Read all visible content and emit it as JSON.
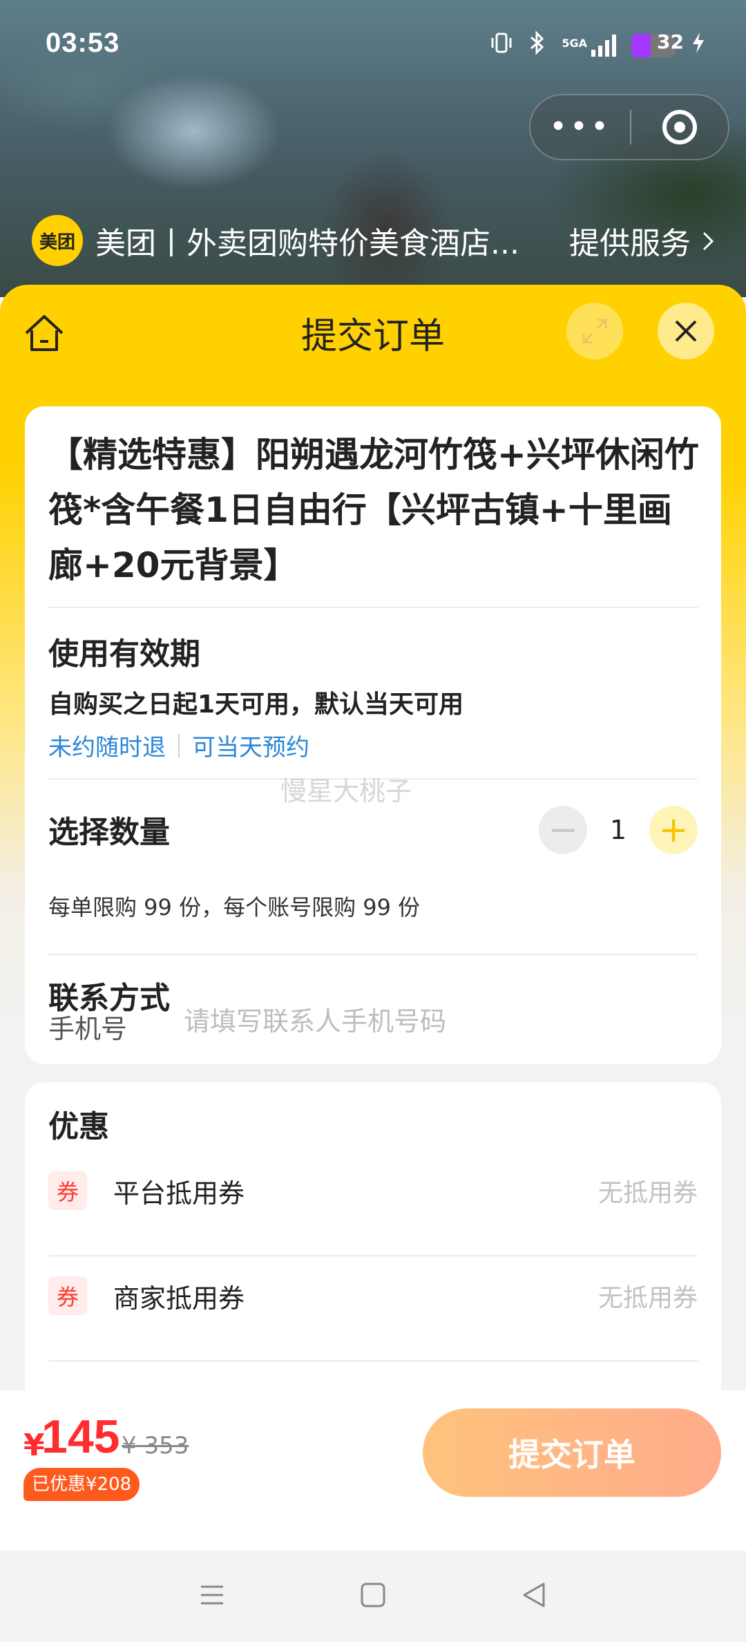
{
  "status_bar": {
    "time": "03:53",
    "network": "5GA",
    "battery": "32",
    "battery_color": "#a238ff"
  },
  "mini_program": {
    "logo_text": "美团",
    "name": "美团丨外卖团购特价美食酒店...",
    "provider_link": "提供服务",
    "capsule_icons": [
      "more-icon",
      "close-program-icon"
    ]
  },
  "header": {
    "title": "提交订单",
    "icons": [
      "home-icon",
      "expand-icon",
      "close-icon"
    ]
  },
  "product": {
    "title": "【精选特惠】阳朔遇龙河竹筏+兴坪休闲竹筏*含午餐1日自由行【兴坪古镇+十里画廊+20元背景】"
  },
  "validity": {
    "title": "使用有效期",
    "text": "自购买之日起1天可用，默认当天可用",
    "tags": [
      "未约随时退",
      "可当天预约"
    ]
  },
  "watermark": "慢星大桃子",
  "quantity": {
    "title": "选择数量",
    "value": "1",
    "minus": "−",
    "plus": "+",
    "limit": "每单限购 99 份，每个账号限购 99 份"
  },
  "contact": {
    "title": "联系方式",
    "phone_label": "手机号",
    "phone_value": "",
    "phone_placeholder": "请填写联系人手机号码"
  },
  "discounts": {
    "title": "优惠",
    "items": [
      {
        "badge": "券",
        "name": "平台抵用券",
        "value": "无抵用券"
      },
      {
        "badge": "券",
        "name": "商家抵用券",
        "value": "无抵用券"
      }
    ]
  },
  "bottom": {
    "currency": "¥",
    "price": "145",
    "original_price": "¥ 353",
    "saved": "已优惠¥208",
    "submit": "提交订单"
  },
  "colors": {
    "brand_yellow": "#ffd100",
    "price_red": "#ff2d2d",
    "link_blue": "#2a86d8",
    "submit_gradient_start": "#ffc37d",
    "submit_gradient_end": "#ffab8a"
  }
}
